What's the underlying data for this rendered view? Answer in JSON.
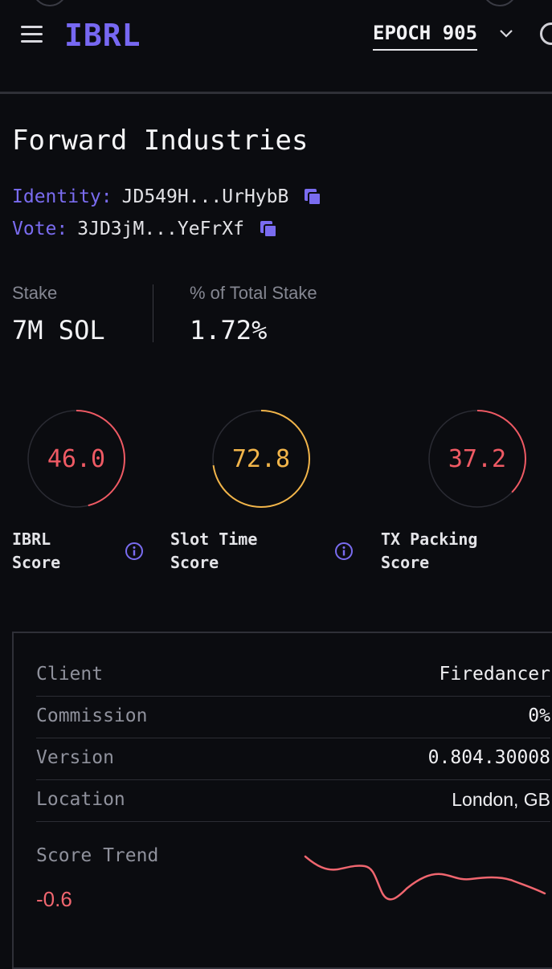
{
  "header": {
    "logo": "IBRL",
    "epoch_label": "EPOCH 905"
  },
  "validator": {
    "name": "Forward Industries",
    "identity_label": "Identity:",
    "identity_value": "JD549H...UrHybB",
    "vote_label": "Vote:",
    "vote_value": "3JD3jM...YeFrXf"
  },
  "stats": {
    "stake_label": "Stake",
    "stake_value": "7M SOL",
    "pct_label": "% of Total Stake",
    "pct_value": "1.72%"
  },
  "scores": [
    {
      "label_line1": "IBRL",
      "label_line2": "Score",
      "value": "46.0",
      "fraction": 0.46,
      "color": "#ef5a64"
    },
    {
      "label_line1": "Slot Time",
      "label_line2": "Score",
      "value": "72.8",
      "fraction": 0.728,
      "color": "#f2b54a"
    },
    {
      "label_line1": "TX Packing",
      "label_line2": "Score",
      "value": "37.2",
      "fraction": 0.372,
      "color": "#ef5a64"
    }
  ],
  "details": {
    "client_label": "Client",
    "client_value": "Firedancer",
    "commission_label": "Commission",
    "commission_value": "0%",
    "version_label": "Version",
    "version_value": "0.804.30008",
    "location_label": "Location",
    "location_value": "London, GB",
    "trend_label": "Score Trend",
    "trend_value": "-0.6"
  },
  "colors": {
    "accent": "#7768f2",
    "score_red": "#ef5a64",
    "score_amber": "#f2b54a",
    "trend_line": "#f0666f"
  },
  "icons": {
    "menu": "menu-icon",
    "chevron": "chevron-down-icon",
    "search": "search-icon",
    "copy": "copy-icon",
    "info": "info-icon"
  }
}
